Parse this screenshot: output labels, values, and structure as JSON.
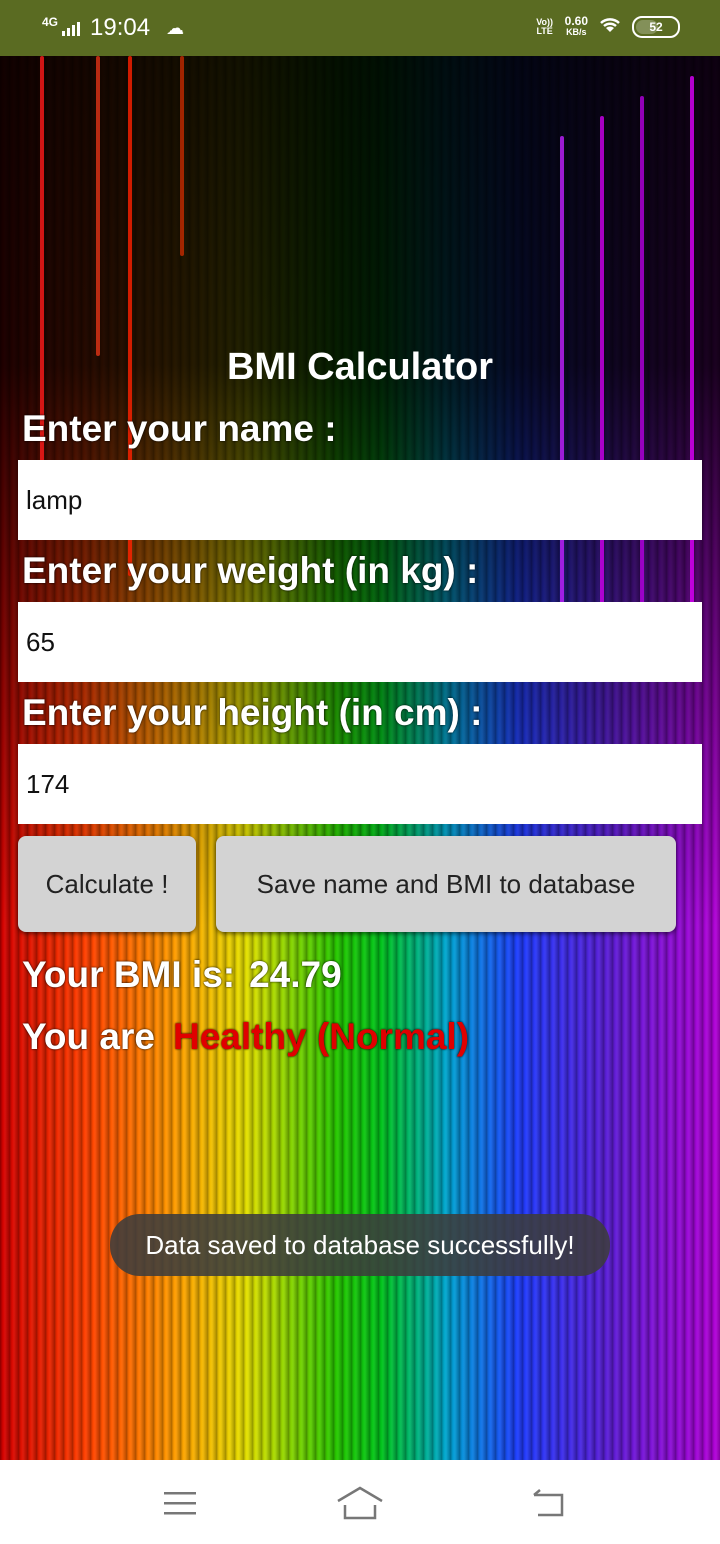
{
  "status_bar": {
    "network": "4G",
    "time": "19:04",
    "volte": "Vo)) LTE",
    "speed_value": "0.60",
    "speed_unit": "KB/s",
    "battery": "52"
  },
  "app": {
    "title": "BMI Calculator",
    "name_label": "Enter your name :",
    "name_value": "lamp",
    "weight_label": "Enter your weight (in kg) :",
    "weight_value": "65",
    "height_label": "Enter your height (in cm) :",
    "height_value": "174",
    "calculate_button": "Calculate !",
    "save_button": "Save name and BMI to database",
    "bmi_label": "Your BMI is:",
    "bmi_value": "24.79",
    "category_label": "You are",
    "category_value": "Healthy (Normal)",
    "category_color": "#e00000"
  },
  "toast": {
    "message": "Data saved to database successfully!"
  },
  "nav": {
    "menu_icon": "menu-icon",
    "home_icon": "home-icon",
    "back_icon": "back-icon"
  }
}
